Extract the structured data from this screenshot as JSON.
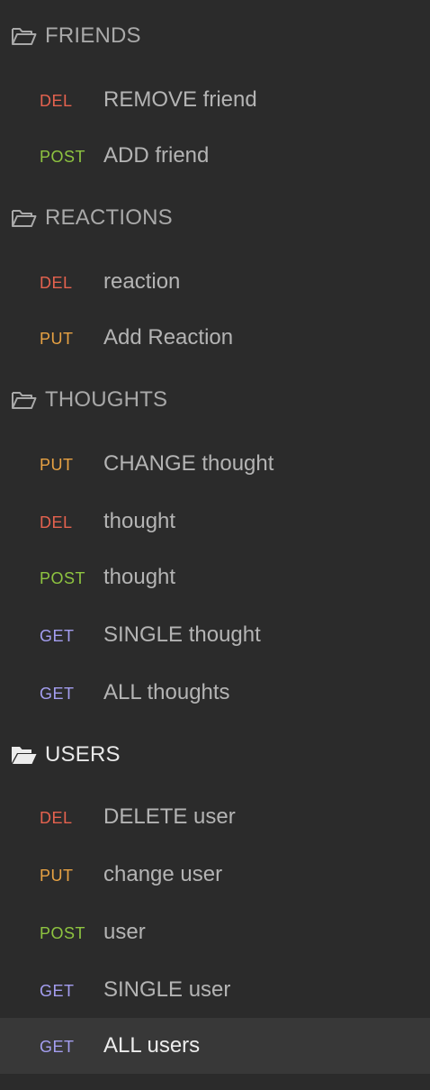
{
  "colors": {
    "background": "#2b2b2b",
    "active_row": "#383838",
    "DEL": "#e5624f",
    "POST": "#8ec440",
    "PUT": "#e8a243",
    "GET": "#a49ef0"
  },
  "folders": [
    {
      "name": "FRIENDS",
      "icon": "folder-outline-icon",
      "requests": [
        {
          "method": "DEL",
          "name": "REMOVE friend"
        },
        {
          "method": "POST",
          "name": "ADD friend"
        }
      ]
    },
    {
      "name": "REACTIONS",
      "icon": "folder-outline-icon",
      "requests": [
        {
          "method": "DEL",
          "name": "reaction"
        },
        {
          "method": "PUT",
          "name": "Add Reaction"
        }
      ]
    },
    {
      "name": "THOUGHTS",
      "icon": "folder-outline-icon",
      "requests": [
        {
          "method": "PUT",
          "name": "CHANGE thought"
        },
        {
          "method": "DEL",
          "name": "thought"
        },
        {
          "method": "POST",
          "name": "thought"
        },
        {
          "method": "GET",
          "name": "SINGLE thought"
        },
        {
          "method": "GET",
          "name": "ALL thoughts"
        }
      ]
    },
    {
      "name": "USERS",
      "icon": "folder-filled-icon",
      "requests": [
        {
          "method": "DEL",
          "name": "DELETE user"
        },
        {
          "method": "PUT",
          "name": "change user"
        },
        {
          "method": "POST",
          "name": "user"
        },
        {
          "method": "GET",
          "name": "SINGLE user"
        },
        {
          "method": "GET",
          "name": "ALL users",
          "selected": true
        }
      ]
    }
  ]
}
